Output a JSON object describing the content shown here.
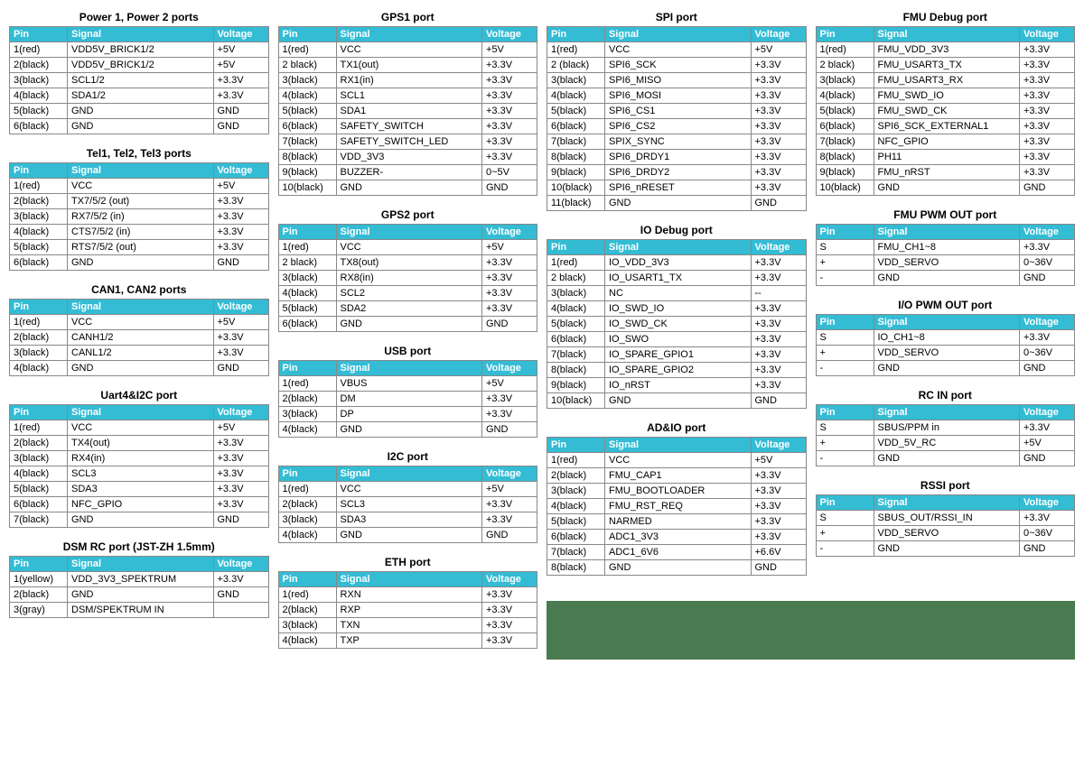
{
  "headers": {
    "pin": "Pin",
    "signal": "Signal",
    "voltage": "Voltage"
  },
  "tables": {
    "power": {
      "title": "Power 1, Power 2 ports",
      "rows": [
        [
          "1(red)",
          "VDD5V_BRICK1/2",
          "+5V"
        ],
        [
          "2(black)",
          "VDD5V_BRICK1/2",
          "+5V"
        ],
        [
          "3(black)",
          "SCL1/2",
          "+3.3V"
        ],
        [
          "4(black)",
          "SDA1/2",
          "+3.3V"
        ],
        [
          "5(black)",
          "GND",
          "GND"
        ],
        [
          "6(black)",
          "GND",
          "GND"
        ]
      ]
    },
    "tel": {
      "title": "Tel1, Tel2, Tel3 ports",
      "rows": [
        [
          "1(red)",
          "VCC",
          "+5V"
        ],
        [
          "2(black)",
          "TX7/5/2 (out)",
          "+3.3V"
        ],
        [
          "3(black)",
          "RX7/5/2 (in)",
          "+3.3V"
        ],
        [
          "4(black)",
          "CTS7/5/2 (in)",
          "+3.3V"
        ],
        [
          "5(black)",
          "RTS7/5/2 (out)",
          "+3.3V"
        ],
        [
          "6(black)",
          "GND",
          "GND"
        ]
      ]
    },
    "can": {
      "title": "CAN1, CAN2 ports",
      "rows": [
        [
          "1(red)",
          "VCC",
          "+5V"
        ],
        [
          "2(black)",
          "CANH1/2",
          "+3.3V"
        ],
        [
          "3(black)",
          "CANL1/2",
          "+3.3V"
        ],
        [
          "4(black)",
          "GND",
          "GND"
        ]
      ]
    },
    "uart4": {
      "title": "Uart4&I2C port",
      "rows": [
        [
          "1(red)",
          "VCC",
          "+5V"
        ],
        [
          "2(black)",
          "TX4(out)",
          "+3.3V"
        ],
        [
          "3(black)",
          "RX4(in)",
          "+3.3V"
        ],
        [
          "4(black)",
          "SCL3",
          "+3.3V"
        ],
        [
          "5(black)",
          "SDA3",
          "+3.3V"
        ],
        [
          "6(black)",
          "NFC_GPIO",
          "+3.3V"
        ],
        [
          "7(black)",
          "GND",
          "GND"
        ]
      ]
    },
    "dsm": {
      "title": "DSM RC port (JST-ZH 1.5mm)",
      "rows": [
        [
          "1(yellow)",
          "VDD_3V3_SPEKTRUM",
          "+3.3V"
        ],
        [
          "2(black)",
          "GND",
          "GND"
        ],
        [
          "3(gray)",
          "DSM/SPEKTRUM IN",
          ""
        ]
      ]
    },
    "gps1": {
      "title": "GPS1 port",
      "rows": [
        [
          "1(red)",
          "VCC",
          "+5V"
        ],
        [
          "2 black)",
          "TX1(out)",
          "+3.3V"
        ],
        [
          "3(black)",
          "RX1(in)",
          "+3.3V"
        ],
        [
          "4(black)",
          "SCL1",
          "+3.3V"
        ],
        [
          "5(black)",
          "SDA1",
          "+3.3V"
        ],
        [
          "6(black)",
          "SAFETY_SWITCH",
          "+3.3V"
        ],
        [
          "7(black)",
          "SAFETY_SWITCH_LED",
          "+3.3V"
        ],
        [
          "8(black)",
          "VDD_3V3",
          "+3.3V"
        ],
        [
          "9(black)",
          "BUZZER-",
          "0~5V"
        ],
        [
          "10(black)",
          "GND",
          "GND"
        ]
      ]
    },
    "gps2": {
      "title": "GPS2 port",
      "rows": [
        [
          "1(red)",
          "VCC",
          "+5V"
        ],
        [
          "2 black)",
          "TX8(out)",
          "+3.3V"
        ],
        [
          "3(black)",
          "RX8(in)",
          "+3.3V"
        ],
        [
          "4(black)",
          "SCL2",
          "+3.3V"
        ],
        [
          "5(black)",
          "SDA2",
          "+3.3V"
        ],
        [
          "6(black)",
          "GND",
          "GND"
        ]
      ]
    },
    "usb": {
      "title": "USB port",
      "rows": [
        [
          "1(red)",
          "VBUS",
          "+5V"
        ],
        [
          "2(black)",
          "DM",
          "+3.3V"
        ],
        [
          "3(black)",
          "DP",
          "+3.3V"
        ],
        [
          "4(black)",
          "GND",
          "GND"
        ]
      ]
    },
    "i2c": {
      "title": "I2C port",
      "rows": [
        [
          "1(red)",
          "VCC",
          "+5V"
        ],
        [
          "2(black)",
          "SCL3",
          "+3.3V"
        ],
        [
          "3(black)",
          "SDA3",
          "+3.3V"
        ],
        [
          "4(black)",
          "GND",
          "GND"
        ]
      ]
    },
    "eth": {
      "title": "ETH port",
      "rows": [
        [
          "1(red)",
          "RXN",
          "+3.3V"
        ],
        [
          "2(black)",
          "RXP",
          "+3.3V"
        ],
        [
          "3(black)",
          "TXN",
          "+3.3V"
        ],
        [
          "4(black)",
          "TXP",
          "+3.3V"
        ]
      ]
    },
    "spi": {
      "title": "SPI port",
      "rows": [
        [
          "1(red)",
          "VCC",
          "+5V"
        ],
        [
          "2 (black)",
          "SPI6_SCK",
          "+3.3V"
        ],
        [
          "3(black)",
          "SPI6_MISO",
          "+3.3V"
        ],
        [
          "4(black)",
          "SPI6_MOSI",
          "+3.3V"
        ],
        [
          "5(black)",
          "SPI6_CS1",
          "+3.3V"
        ],
        [
          "6(black)",
          "SPI6_CS2",
          "+3.3V"
        ],
        [
          "7(black)",
          "SPIX_SYNC",
          "+3.3V"
        ],
        [
          "8(black)",
          "SPI6_DRDY1",
          "+3.3V"
        ],
        [
          "9(black)",
          "SPI6_DRDY2",
          "+3.3V"
        ],
        [
          "10(black)",
          "SPI6_nRESET",
          "+3.3V"
        ],
        [
          "11(black)",
          "GND",
          "GND"
        ]
      ]
    },
    "iodebug": {
      "title": "IO Debug port",
      "rows": [
        [
          "1(red)",
          "IO_VDD_3V3",
          "+3.3V"
        ],
        [
          "2 black)",
          "IO_USART1_TX",
          "+3.3V"
        ],
        [
          "3(black)",
          "NC",
          "--"
        ],
        [
          "4(black)",
          "IO_SWD_IO",
          "+3.3V"
        ],
        [
          "5(black)",
          "IO_SWD_CK",
          "+3.3V"
        ],
        [
          "6(black)",
          "IO_SWO",
          "+3.3V"
        ],
        [
          "7(black)",
          "IO_SPARE_GPIO1",
          "+3.3V"
        ],
        [
          "8(black)",
          "IO_SPARE_GPIO2",
          "+3.3V"
        ],
        [
          "9(black)",
          "IO_nRST",
          "+3.3V"
        ],
        [
          "10(black)",
          "GND",
          "GND"
        ]
      ]
    },
    "adio": {
      "title": "AD&IO port",
      "rows": [
        [
          "1(red)",
          "VCC",
          "+5V"
        ],
        [
          "2(black)",
          "FMU_CAP1",
          "+3.3V"
        ],
        [
          "3(black)",
          "FMU_BOOTLOADER",
          "+3.3V"
        ],
        [
          "4(black)",
          "FMU_RST_REQ",
          "+3.3V"
        ],
        [
          "5(black)",
          "NARMED",
          "+3.3V"
        ],
        [
          "6(black)",
          "ADC1_3V3",
          "+3.3V"
        ],
        [
          "7(black)",
          "ADC1_6V6",
          "+6.6V"
        ],
        [
          "8(black)",
          "GND",
          "GND"
        ]
      ]
    },
    "fmudebug": {
      "title": "FMU Debug port",
      "rows": [
        [
          "1(red)",
          "FMU_VDD_3V3",
          "+3.3V"
        ],
        [
          "2 black)",
          "FMU_USART3_TX",
          "+3.3V"
        ],
        [
          "3(black)",
          "FMU_USART3_RX",
          "+3.3V"
        ],
        [
          "4(black)",
          "FMU_SWD_IO",
          "+3.3V"
        ],
        [
          "5(black)",
          "FMU_SWD_CK",
          "+3.3V"
        ],
        [
          "6(black)",
          "SPI6_SCK_EXTERNAL1",
          "+3.3V"
        ],
        [
          "7(black)",
          "NFC_GPIO",
          "+3.3V"
        ],
        [
          "8(black)",
          "PH11",
          "+3.3V"
        ],
        [
          "9(black)",
          "FMU_nRST",
          "+3.3V"
        ],
        [
          "10(black)",
          "GND",
          "GND"
        ]
      ]
    },
    "fmupwm": {
      "title": "FMU PWM OUT port",
      "rows": [
        [
          "S",
          "FMU_CH1~8",
          "+3.3V"
        ],
        [
          "+",
          "VDD_SERVO",
          "0~36V"
        ],
        [
          "-",
          "GND",
          "GND"
        ]
      ]
    },
    "iopwm": {
      "title": "I/O PWM OUT port",
      "rows": [
        [
          "S",
          "IO_CH1~8",
          "+3.3V"
        ],
        [
          "+",
          "VDD_SERVO",
          "0~36V"
        ],
        [
          "-",
          "GND",
          "GND"
        ]
      ]
    },
    "rcin": {
      "title": "RC IN port",
      "rows": [
        [
          "S",
          "SBUS/PPM in",
          "+3.3V"
        ],
        [
          "+",
          "VDD_5V_RC",
          "+5V"
        ],
        [
          "-",
          "GND",
          "GND"
        ]
      ]
    },
    "rssi": {
      "title": "RSSI port",
      "rows": [
        [
          "S",
          "SBUS_OUT/RSSI_IN",
          "+3.3V"
        ],
        [
          "+",
          "VDD_SERVO",
          "0~36V"
        ],
        [
          "-",
          "GND",
          "GND"
        ]
      ]
    }
  }
}
